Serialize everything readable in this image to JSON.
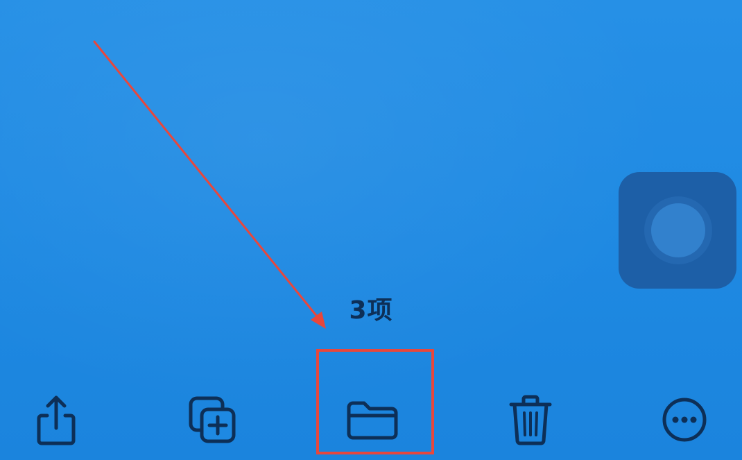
{
  "selection": {
    "count_label": "3项"
  },
  "toolbar": {
    "items": [
      {
        "icon": "share-icon",
        "action": "share"
      },
      {
        "icon": "duplicate-icon",
        "action": "duplicate"
      },
      {
        "icon": "folder-icon",
        "action": "move"
      },
      {
        "icon": "trash-icon",
        "action": "delete"
      },
      {
        "icon": "more-icon",
        "action": "more"
      }
    ]
  },
  "colors": {
    "background": "#1e8ae3",
    "icon": "#0d2f57",
    "annotation": "#e8473c",
    "assistive_touch": "#1d5fa7"
  }
}
